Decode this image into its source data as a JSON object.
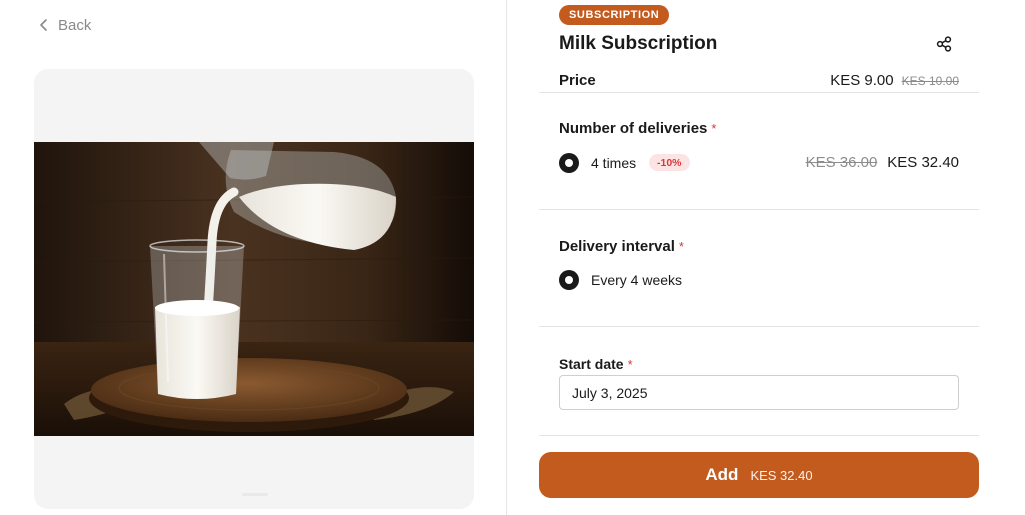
{
  "nav": {
    "back_label": "Back"
  },
  "product": {
    "badge": "SUBSCRIPTION",
    "title": "Milk Subscription",
    "price_label": "Price",
    "price_current": "KES 9.00",
    "price_original": "KES 10.00"
  },
  "deliveries": {
    "title": "Number of deliveries",
    "required": "*",
    "option": {
      "label": "4 times",
      "discount": "-10%",
      "price_original": "KES 36.00",
      "price_current": "KES 32.40",
      "selected": true
    }
  },
  "interval": {
    "title": "Delivery interval",
    "required": "*",
    "option": {
      "label": "Every 4 weeks",
      "selected": true
    }
  },
  "start_date": {
    "title": "Start date",
    "required": "*",
    "value": "July 3, 2025"
  },
  "cart": {
    "add_label": "Add",
    "add_price": "KES 32.40"
  },
  "colors": {
    "accent": "#c35a1e",
    "required": "#d23a3a",
    "discount_bg": "#fde4e4"
  },
  "icons": {
    "back": "chevron-left-icon",
    "share": "share-icon"
  }
}
